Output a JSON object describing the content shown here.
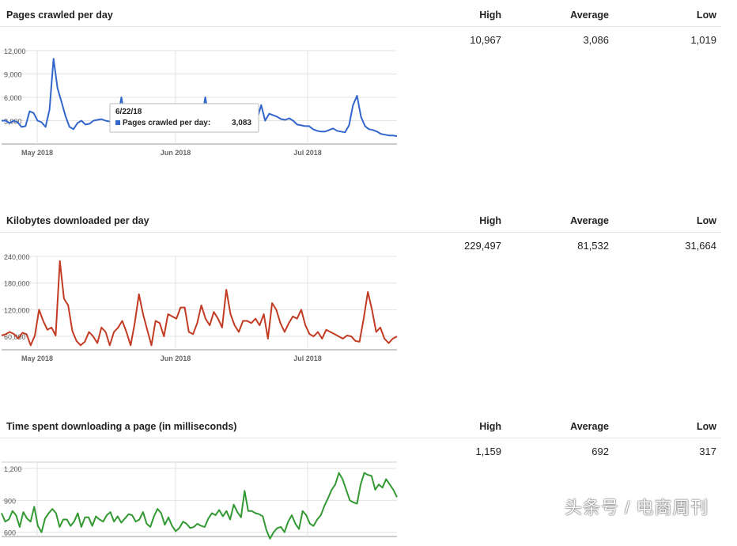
{
  "sections": [
    {
      "title": "Pages crawled per day",
      "headers": {
        "high": "High",
        "average": "Average",
        "low": "Low"
      },
      "stats": {
        "high": "10,967",
        "average": "3,086",
        "low": "1,019"
      },
      "color": "#3366cc"
    },
    {
      "title": "Kilobytes downloaded per day",
      "headers": {
        "high": "High",
        "average": "Average",
        "low": "Low"
      },
      "stats": {
        "high": "229,497",
        "average": "81,532",
        "low": "31,664"
      },
      "color": "#c23b22"
    },
    {
      "title": "Time spent downloading a page (in milliseconds)",
      "headers": {
        "high": "High",
        "average": "Average",
        "low": "Low"
      },
      "stats": {
        "high": "1,159",
        "average": "692",
        "low": "317"
      },
      "color": "#339933"
    }
  ],
  "tooltip": {
    "date": "6/22/18",
    "label": "Pages crawled per day:",
    "value": "3,083"
  },
  "watermark": "头条号 / 电商周刊",
  "chart_data": [
    {
      "type": "line",
      "x_tick_labels": [
        "May 2018",
        "Jun 2018",
        "Jul 2018"
      ],
      "y_tick_labels": [
        "3,000",
        "6,000",
        "9,000",
        "12,000"
      ],
      "ylim": [
        0,
        12000
      ],
      "series": [
        {
          "values": [
            3000,
            3000,
            2700,
            3000,
            2800,
            2200,
            2300,
            4200,
            4000,
            3000,
            2800,
            2200,
            4400,
            10967,
            7200,
            5400,
            3600,
            2200,
            1900,
            2700,
            3000,
            2500,
            2600,
            3000,
            3100,
            3200,
            3000,
            2900,
            3000,
            3000,
            6000,
            3000,
            3200,
            3000,
            2900,
            3000,
            3000,
            3000,
            3000,
            3100,
            3000,
            3083,
            3000,
            3100,
            3500,
            3200,
            3200,
            3000,
            3000,
            3200,
            3000,
            6000,
            3000,
            2600,
            2800,
            3100,
            3500,
            3200,
            3100,
            3000,
            3200,
            3000,
            3100,
            3000,
            3200,
            5000,
            3000,
            3900,
            3700,
            3500,
            3200,
            3100,
            3300,
            3000,
            2500,
            2400,
            2300,
            2300,
            1900,
            1700,
            1600,
            1600,
            1800,
            2000,
            1700,
            1600,
            1500,
            2400,
            5000,
            6200,
            3500,
            2300,
            1900,
            1800,
            1600,
            1300,
            1200,
            1100,
            1100,
            1019
          ]
        }
      ]
    },
    {
      "type": "line",
      "x_tick_labels": [
        "May 2018",
        "Jun 2018",
        "Jul 2018"
      ],
      "y_tick_labels": [
        "60,000",
        "120,000",
        "180,000",
        "240,000"
      ],
      "ylim": [
        30000,
        240000
      ],
      "series": [
        {
          "values": [
            62000,
            65000,
            70000,
            65000,
            55000,
            68000,
            65000,
            40000,
            62000,
            120000,
            95000,
            75000,
            80000,
            62000,
            229497,
            145000,
            130000,
            72000,
            50000,
            40000,
            48000,
            70000,
            60000,
            45000,
            80000,
            70000,
            40000,
            70000,
            80000,
            95000,
            70000,
            40000,
            90000,
            155000,
            110000,
            75000,
            40000,
            95000,
            90000,
            60000,
            110000,
            105000,
            100000,
            125000,
            125000,
            70000,
            65000,
            90000,
            130000,
            100000,
            85000,
            115000,
            100000,
            80000,
            165000,
            110000,
            85000,
            70000,
            95000,
            95000,
            90000,
            100000,
            85000,
            110000,
            55000,
            135000,
            120000,
            90000,
            70000,
            90000,
            105000,
            100000,
            120000,
            85000,
            65000,
            60000,
            70000,
            55000,
            75000,
            70000,
            65000,
            60000,
            55000,
            62000,
            60000,
            50000,
            48000,
            100000,
            160000,
            120000,
            70000,
            80000,
            55000,
            45000,
            55000,
            60000
          ]
        }
      ]
    },
    {
      "type": "line",
      "x_tick_labels": [],
      "y_tick_labels": [
        "600",
        "900",
        "1,200"
      ],
      "ylim": [
        560,
        1260
      ],
      "series": [
        {
          "values": [
            780,
            700,
            720,
            800,
            760,
            650,
            790,
            730,
            700,
            840,
            660,
            600,
            730,
            780,
            820,
            780,
            650,
            720,
            720,
            660,
            700,
            780,
            650,
            740,
            740,
            660,
            750,
            720,
            700,
            760,
            790,
            700,
            750,
            690,
            730,
            770,
            760,
            700,
            720,
            790,
            680,
            650,
            750,
            820,
            780,
            670,
            740,
            660,
            610,
            640,
            700,
            680,
            640,
            650,
            680,
            660,
            650,
            730,
            780,
            760,
            810,
            750,
            800,
            720,
            860,
            790,
            740,
            990,
            800,
            800,
            780,
            770,
            750,
            620,
            540,
            600,
            640,
            650,
            600,
            700,
            760,
            680,
            630,
            800,
            760,
            680,
            660,
            720,
            760,
            850,
            920,
            1000,
            1050,
            1159,
            1100,
            1000,
            900,
            880,
            870,
            1050,
            1159,
            1140,
            1130,
            1000,
            1050,
            1020,
            1100,
            1050,
            1000,
            930
          ]
        }
      ]
    }
  ]
}
